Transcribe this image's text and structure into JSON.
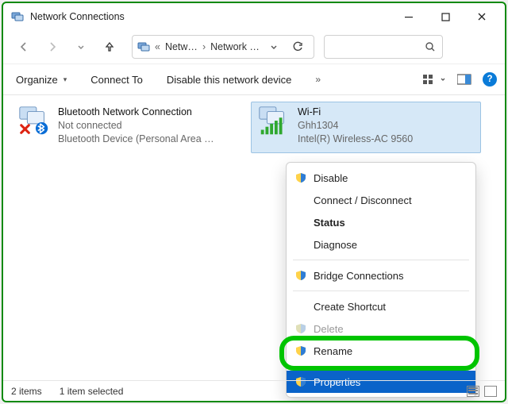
{
  "window": {
    "title": "Network Connections"
  },
  "breadcrumb": {
    "crumb1": "Netw…",
    "crumb2": "Network …"
  },
  "toolbar": {
    "organize": "Organize",
    "connect_to": "Connect To",
    "disable": "Disable this network device",
    "overflow": "»"
  },
  "connections": [
    {
      "name": "Bluetooth Network Connection",
      "status": "Not connected",
      "device": "Bluetooth Device (Personal Area …"
    },
    {
      "name": "Wi-Fi",
      "status": "Ghh1304",
      "device": "Intel(R) Wireless-AC 9560"
    }
  ],
  "context_menu": {
    "disable": "Disable",
    "connect_disconnect": "Connect / Disconnect",
    "status": "Status",
    "diagnose": "Diagnose",
    "bridge": "Bridge Connections",
    "create_shortcut": "Create Shortcut",
    "delete": "Delete",
    "rename": "Rename",
    "properties": "Properties"
  },
  "statusbar": {
    "count": "2 items",
    "selection": "1 item selected"
  }
}
